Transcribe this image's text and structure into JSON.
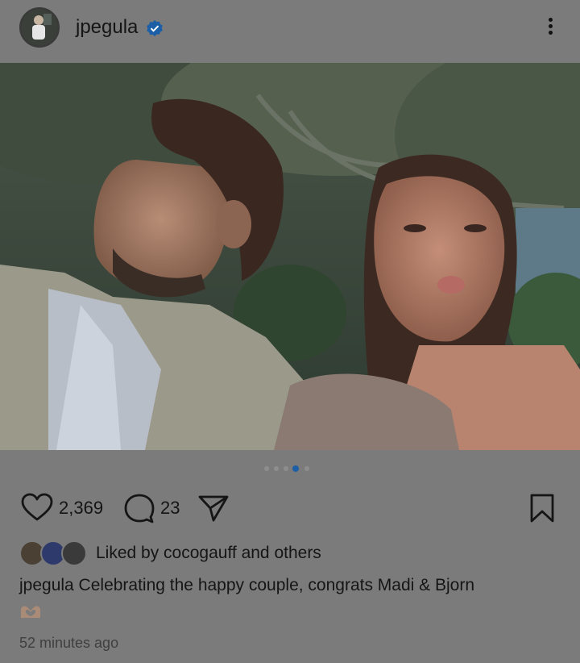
{
  "post": {
    "username": "jpegula",
    "verified": true,
    "likes": "2,369",
    "comments": "23",
    "liked_by": "Liked by cocogauff and others",
    "caption": "jpegula Celebrating the happy couple, congrats Madi & Bjorn",
    "caption_emoji": "heart-hands-emoji",
    "timestamp": "52 minutes ago"
  },
  "carousel": {
    "total": 5,
    "active_index": 3
  },
  "icons": {
    "verified": "verified-badge-icon",
    "more": "more-options-icon",
    "like": "heart-icon",
    "comment": "comment-icon",
    "share": "send-icon",
    "save": "bookmark-icon"
  },
  "colors": {
    "background": "#7b7b7b",
    "accent": "#1c5fa6",
    "text": "#151515"
  }
}
